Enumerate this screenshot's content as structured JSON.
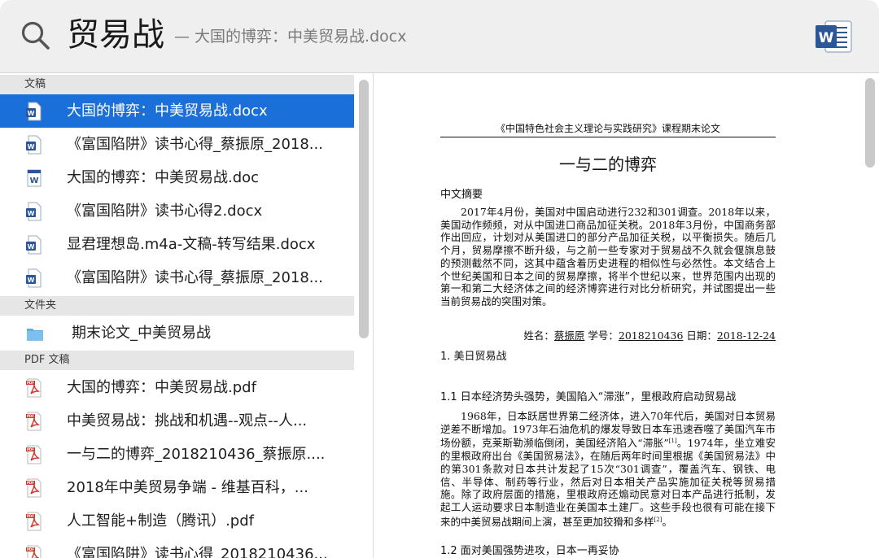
{
  "search": {
    "query": "贸易战",
    "subtitle": "— 大国的博弈：中美贸易战.docx"
  },
  "icons": {
    "search": "search-icon",
    "app": "word-app-icon",
    "word_doc": "word-document-icon",
    "pdf": "pdf-document-icon",
    "folder": "folder-icon"
  },
  "colors": {
    "selection": "#1b6fd8",
    "word_blue": "#2b5797",
    "pdf_red": "#d0352d",
    "folder_blue": "#5aaee8"
  },
  "results": {
    "sections": {
      "documents": "文稿",
      "folders": "文件夹",
      "pdf": "PDF 文稿"
    },
    "documents": [
      "大国的博弈：中美贸易战.docx",
      "《富国陷阱》读书心得_蔡振原_2018...",
      "大国的博弈：中美贸易战.doc",
      "《富国陷阱》读书心得2.docx",
      "显君理想岛.m4a-文稿-转写结果.docx",
      "《富国陷阱》读书心得_蔡振原_2018..."
    ],
    "folders": [
      "期末论文_中美贸易战"
    ],
    "pdfs": [
      "大国的博弈：中美贸易战.pdf",
      "中美贸易战：挑战和机遇--观点--人...",
      "一与二的博弈_2018210436_蔡振原....",
      "2018年中美贸易争端 - 维基百科，...",
      "人工智能+制造（腾讯）.pdf",
      "《富国陷阱》读书心得_2018210436..."
    ]
  },
  "preview": {
    "header": "《中国特色社会主义理论与实践研究》课程期末论文",
    "title": "一与二的博弈",
    "abstract_heading": "中文摘要",
    "abstract": "2017年4月份，美国对中国启动进行232和301调查。2018年以来，美国动作频频，对从中国进口商品加征关税。2018年3月份，中国商务部作出回应，计划对从美国进口的部分产品加征关税，以平衡损失。随后几个月，贸易摩擦不断升级，与之前一些专家对于贸易战不久就会偃旗息鼓的预测截然不同，这其中蕴含着历史进程的相似性与必然性。本文结合上个世纪美国和日本之间的贸易摩擦，将半个世纪以来，世界范围内出现的第一和第二大经济体之间的经济博弈进行对比分析研究，并试图提出一些当前贸易战的突围对策。",
    "meta": {
      "name_label": "姓名：",
      "name": "蔡振原",
      "id_label": " 学号：",
      "id": "2018210436",
      "date_label": " 日期：",
      "date": "2018-12-24"
    },
    "h1": "1. 美日贸易战",
    "h1_1": "1.1 日本经济势头强势，美国陷入“滞涨”，里根政府启动贸易战",
    "para1_a": "1968年，日本跃居世界第二经济体，进入70年代后，美国对日本贸易逆差不断增加。1973年石油危机的爆发导致日本车迅速吞噬了美国汽车市场份额，克莱斯勒濒临倒闭，美国经济陷入“滞胀”",
    "para1_sup1": "[1]",
    "para1_b": "。1974年，坐立难安的里根政府出台《美国贸易法》，在随后两年时间里根据《美国贸易法》中的第301条款对日本共计发起了15次“301调查”，覆盖汽车、钢铁、电信、半导体、制药等行业，然后对日本相关产品实施加征关税等贸易措施。除了政府层面的措施，里根政府还煽动民意对日本产品进行抵制，发起工人运动要求日本制造业在美国本土建厂。这些手段也很有可能在接下来的中美贸易战期间上演，甚至更加狡猾和多样",
    "para1_sup2": "[2]",
    "para1_c": "。",
    "h1_2": "1.2 面对美国强势进攻，日本一再妥协"
  }
}
